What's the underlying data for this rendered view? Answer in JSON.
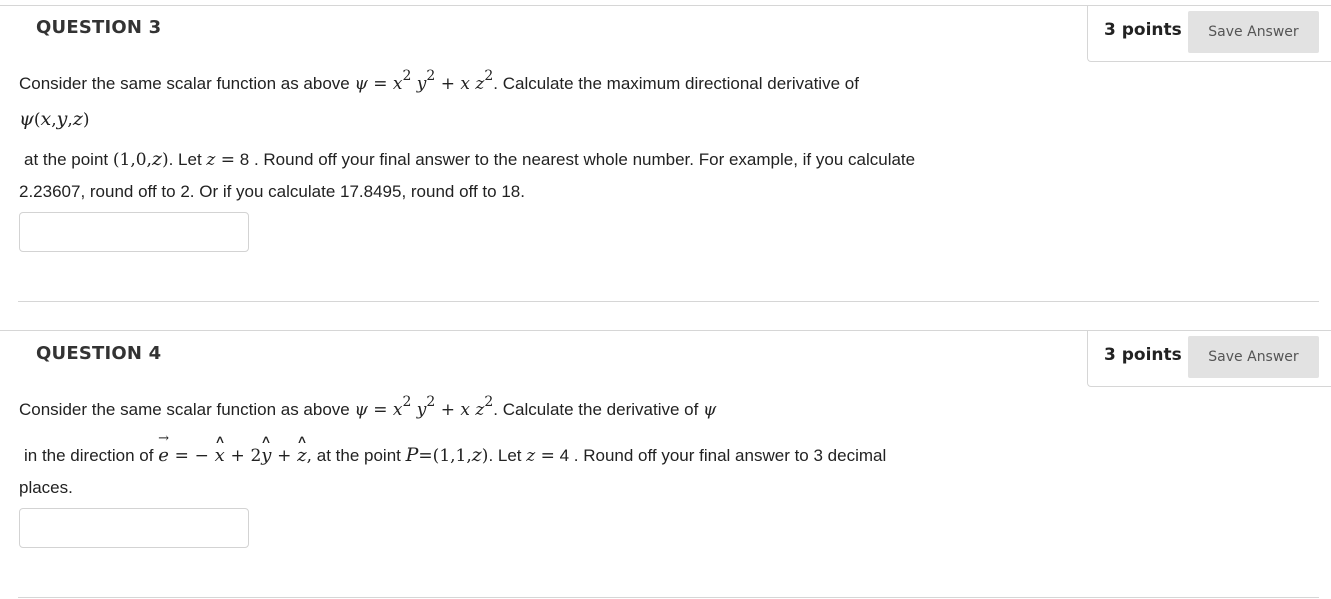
{
  "q3": {
    "title": "QUESTION 3",
    "points": "3 points",
    "save_label": "Save Answer",
    "l1_a": "Consider the same scalar function as above ",
    "l1_b": ". Calculate the maximum directional derivative of",
    "l3_a": "at the point ",
    "l3_b": ". Let ",
    "l3_c": " 8 . Round off your final answer to the nearest whole number. For example, if you calculate",
    "l4": "2.23607, round off to 2. Or if you calculate 17.8495, round off to 18.",
    "answer_value": ""
  },
  "q4": {
    "title": "QUESTION 4",
    "points": "3 points",
    "save_label": "Save Answer",
    "l1_a": "Consider the same scalar function as above ",
    "l1_b": ". Calculate the derivative of ",
    "l2_a": "in the direction of ",
    "l2_b": " at the point ",
    "l2_c": ". Let ",
    "l2_d": " 4 . Round off your final answer to 3 decimal",
    "l3": "places.",
    "answer_value": ""
  }
}
